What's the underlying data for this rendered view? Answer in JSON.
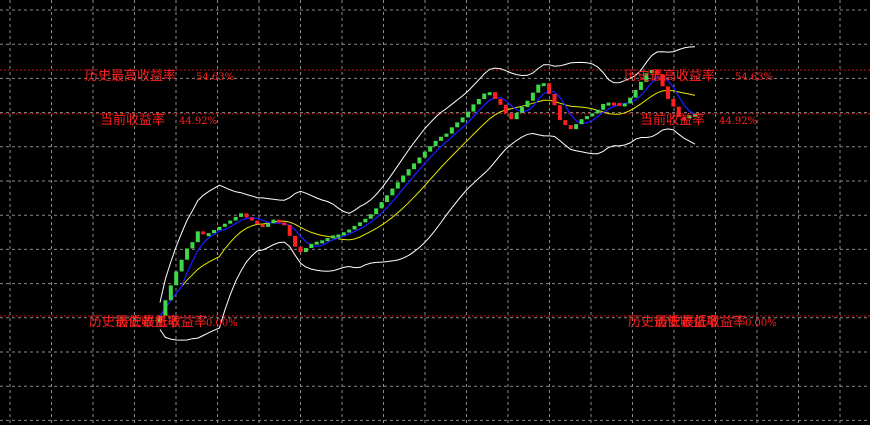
{
  "chart_data": {
    "type": "candlestick",
    "grid": true,
    "background": "#000000",
    "colors": {
      "up": "#3ed94a",
      "down": "#ff2020",
      "ma_fast": "#1a1aff",
      "ma_slow": "#e8e800",
      "band": "#ffffff",
      "ref_line": "#cc1111",
      "grid": "#8a8a8a"
    },
    "reference_lines": [
      {
        "value": 54.63,
        "label_text": "历史最高收益率",
        "label_value": "54.63%"
      },
      {
        "value": 44.92,
        "label_text": "当前收益率",
        "label_value": "44.92%"
      },
      {
        "value": 0.0,
        "label_text": "历史最低收益率",
        "label_value": "0.00%"
      }
    ],
    "overlap_text": "历史最低收益率",
    "overlap_value": "0.00%",
    "close": [
      0.0,
      3.5,
      6.8,
      9.9,
      12.5,
      15.0,
      16.4,
      18.8,
      18.2,
      18.4,
      19.1,
      19.8,
      20.5,
      21.2,
      22.0,
      22.8,
      21.9,
      21.2,
      20.4,
      19.8,
      20.6,
      21.4,
      20.8,
      20.2,
      17.8,
      15.4,
      14.2,
      15.1,
      16.0,
      16.5,
      16.8,
      17.3,
      17.9,
      18.1,
      18.6,
      19.2,
      20.0,
      20.8,
      21.6,
      22.6,
      23.9,
      25.3,
      26.8,
      28.3,
      29.7,
      31.2,
      32.6,
      33.9,
      35.2,
      36.5,
      37.7,
      38.9,
      39.8,
      40.5,
      41.9,
      43.0,
      44.1,
      45.4,
      47.0,
      48.2,
      49.4,
      49.7,
      48.2,
      46.9,
      45.0,
      43.7,
      45.1,
      46.4,
      47.8,
      49.6,
      51.4,
      51.7,
      49.3,
      46.8,
      43.5,
      42.4,
      41.5,
      42.6,
      43.7,
      44.4,
      45.0,
      45.8,
      47.1,
      47.4,
      47.3,
      47.0,
      47.2,
      48.5,
      50.2,
      52.0,
      53.9,
      54.63,
      53.7,
      51.0,
      48.2,
      46.5,
      44.2,
      43.9,
      44.6,
      44.92
    ]
  }
}
